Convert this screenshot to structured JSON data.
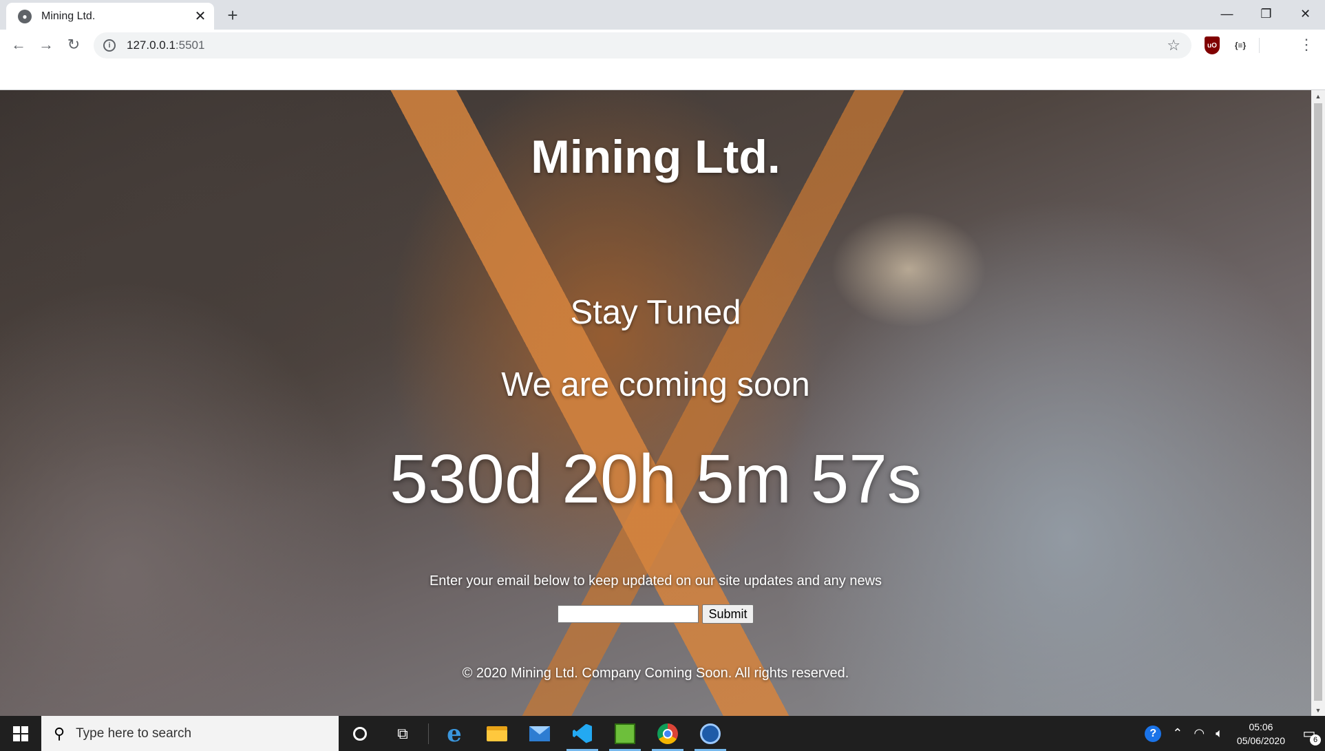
{
  "browser": {
    "tab_title": "Mining Ltd.",
    "url_host": "127.0.0.1",
    "url_port": ":5501",
    "extension_json_label": "{≡}",
    "extension_ublock_label": "uO"
  },
  "page": {
    "title": "Mining Ltd.",
    "tagline_1": "Stay Tuned",
    "tagline_2": "We are coming soon",
    "countdown": "530d 20h 5m 57s",
    "subscribe_text": "Enter your email below to keep updated on our site updates and any news",
    "email_value": "",
    "submit_label": "Submit",
    "footer": "© 2020 Mining Ltd. Company Coming Soon. All rights reserved."
  },
  "taskbar": {
    "search_placeholder": "Type here to search",
    "time": "05:06",
    "date": "05/06/2020",
    "notification_count": "6",
    "pinned": [
      "edge-icon",
      "file-explorer-icon",
      "mail-icon",
      "vscode-icon",
      "app-icon",
      "chrome-icon",
      "obs-icon"
    ]
  },
  "colors": {
    "taskbar_bg": "#1f1f1f",
    "tabbar_bg": "#dee1e6",
    "active_indicator": "#76b9ed"
  }
}
